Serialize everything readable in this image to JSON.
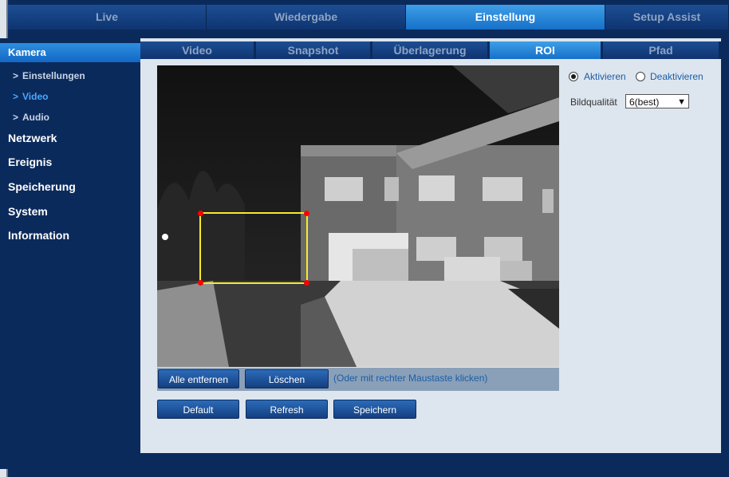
{
  "top_nav": {
    "tabs": [
      {
        "label": "Live"
      },
      {
        "label": "Wiedergabe"
      },
      {
        "label": "Einstellung"
      },
      {
        "label": "Setup Assist"
      }
    ],
    "active": "Einstellung"
  },
  "sidebar": {
    "header": "Kamera",
    "sub_items": [
      {
        "chevron": ">",
        "label": "Einstellungen"
      },
      {
        "chevron": ">",
        "label": "Video"
      },
      {
        "chevron": ">",
        "label": "Audio"
      }
    ],
    "active_sub": "Video",
    "sections": [
      {
        "label": "Netzwerk"
      },
      {
        "label": "Ereignis"
      },
      {
        "label": "Speicherung"
      },
      {
        "label": "System"
      },
      {
        "label": "Information"
      }
    ]
  },
  "sub_tabs": {
    "tabs": [
      {
        "label": "Video"
      },
      {
        "label": "Snapshot"
      },
      {
        "label": "Überlagerung"
      },
      {
        "label": "ROI"
      },
      {
        "label": "Pfad"
      }
    ],
    "active": "ROI"
  },
  "roi_panel": {
    "activate_label": "Aktivieren",
    "deactivate_label": "Deaktivieren",
    "activated": true,
    "quality_label": "Bildqualität",
    "quality_value": "6(best)"
  },
  "video_controls": {
    "remove_all_label": "Alle entfernen",
    "delete_label": "Löschen",
    "hint": "(Oder mit rechter Maustaste klicken)"
  },
  "actions": {
    "default_label": "Default",
    "refresh_label": "Refresh",
    "save_label": "Speichern"
  },
  "colors": {
    "nav_active": "#1670c9",
    "roi_box": "#f4ec2a",
    "roi_handle": "#ff0000"
  }
}
